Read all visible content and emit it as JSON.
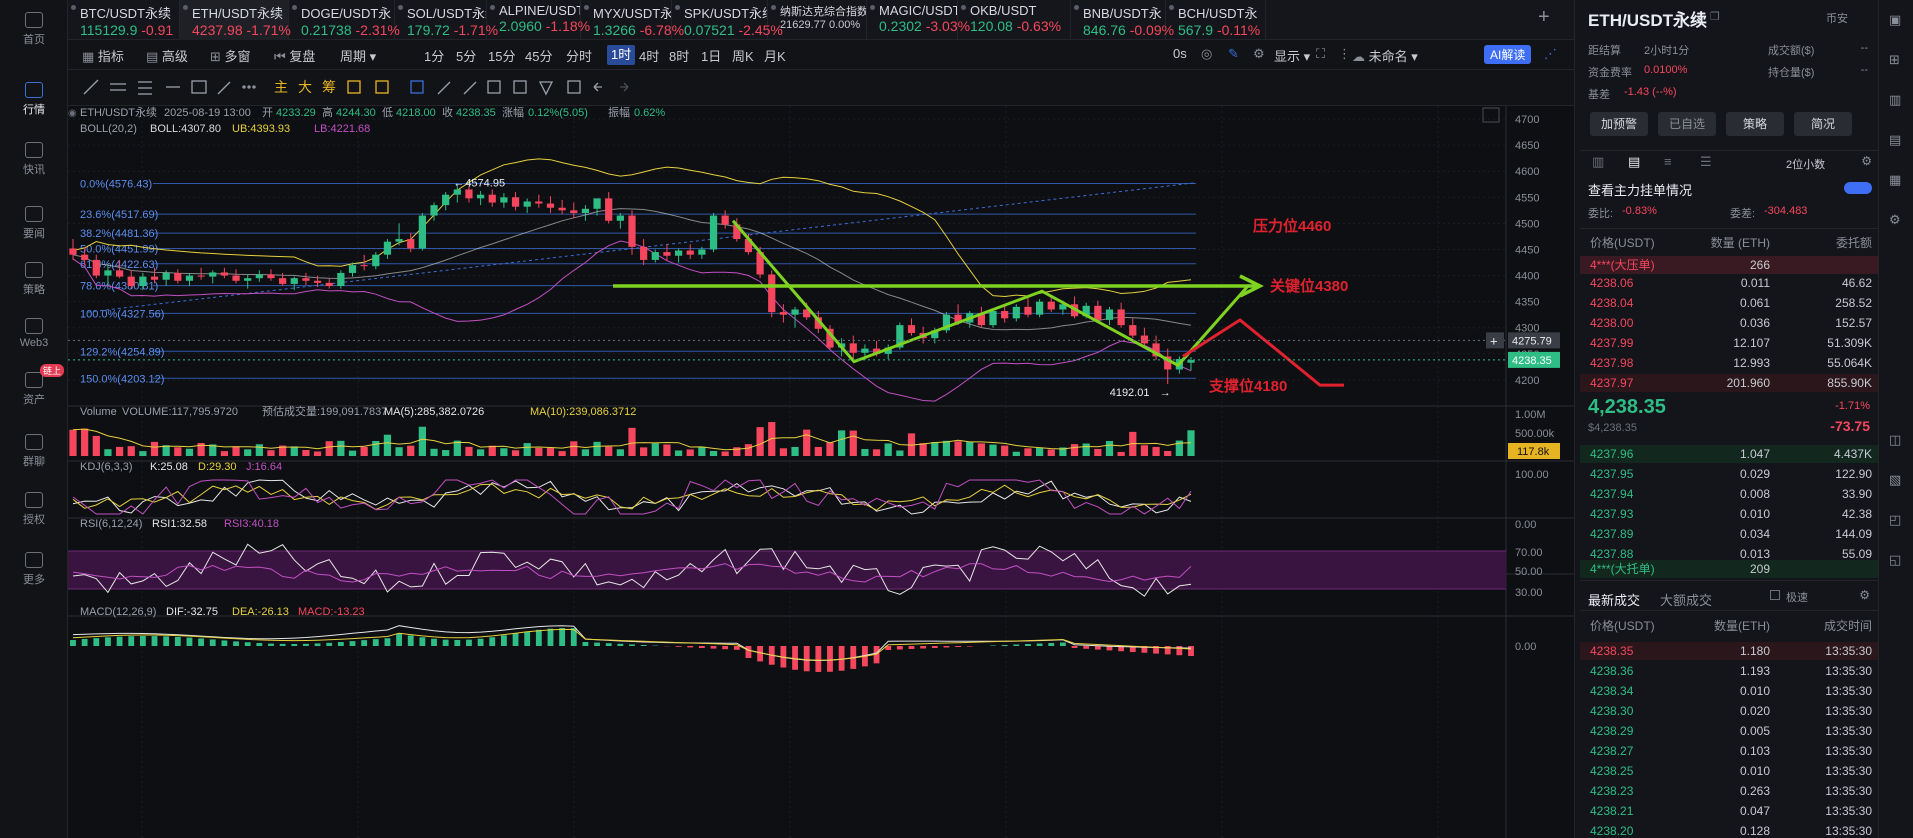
{
  "nav": [
    {
      "label": "首页",
      "icon": "home-icon"
    },
    {
      "label": "行情",
      "icon": "market-chart-icon",
      "active": true
    },
    {
      "label": "快讯",
      "icon": "flash-news-icon"
    },
    {
      "label": "要闻",
      "icon": "news-icon"
    },
    {
      "label": "策略",
      "icon": "strategy-robot-icon"
    },
    {
      "label": "Web3",
      "icon": "web3-icon"
    },
    {
      "label": "资产",
      "icon": "wallet-icon",
      "badge": "链上"
    },
    {
      "label": "群聊",
      "icon": "chat-icon"
    },
    {
      "label": "授权",
      "icon": "auth-icon"
    },
    {
      "label": "更多",
      "icon": "more-icon"
    }
  ],
  "tickers": [
    {
      "name": "BTC/USDT永续",
      "price": "115129.9",
      "change": "-0.91"
    },
    {
      "name": "ETH/USDT永续",
      "price": "4237.98",
      "change": "-1.71%",
      "selected": true
    },
    {
      "name": "DOGE/USDT永",
      "price": "0.21738",
      "change": "-2.31%"
    },
    {
      "name": "SOL/USDT永续",
      "price": "179.72",
      "change": "-1.71%"
    },
    {
      "name": "ALPINE/USDT",
      "price": "2.0960",
      "change": "-1.18%"
    },
    {
      "name": "MYX/USDT永",
      "price": "1.3266",
      "change": "-6.78%"
    },
    {
      "name": "SPK/USDT永续",
      "price": "0.07521",
      "change": "-2.45%"
    },
    {
      "name": "纳斯达克综合指数",
      "price": "21629.77",
      "change": "0.00%",
      "neutral": true
    },
    {
      "name": "MAGIC/USDT",
      "price": "0.2302",
      "change": "-3.03%"
    },
    {
      "name": "OKB/USDT",
      "price": "120.08",
      "change": "-0.63%"
    },
    {
      "name": "BNB/USDT永",
      "price": "846.76",
      "change": "-0.09%"
    },
    {
      "name": "BCH/USDT永",
      "price": "567.9",
      "change": "-0.11%"
    }
  ],
  "add_tab": "+",
  "toolbar": {
    "indicators": "指标",
    "advanced": "高级",
    "multi": "多窗",
    "replay": "复盘",
    "period": "周期",
    "intervals": [
      "1分",
      "5分",
      "15分",
      "45分",
      "分时",
      "1时",
      "4时",
      "8时",
      "1日",
      "周K",
      "月K"
    ],
    "active_interval": "1时",
    "zero_s": "0s",
    "display": "显示",
    "unnamed": "未命名",
    "ai": "AI解读"
  },
  "chart_header": {
    "symbol": "ETH/USDT永续",
    "date": "2025-08-19 13:00",
    "open_label": "开",
    "open": "4233.29",
    "high_label": "高",
    "high": "4244.30",
    "low_label": "低",
    "low": "4218.00",
    "close_label": "收",
    "close": "4238.35",
    "chg_label": "涨幅",
    "chg": "0.12%(5.05)",
    "amp_label": "振幅",
    "amp": "0.62%",
    "boll": "BOLL(20,2)",
    "boll_mid": "BOLL:4307.80",
    "boll_ub": "UB:4393.93",
    "boll_lb": "LB:4221.68"
  },
  "volume_header": {
    "title": "Volume",
    "vol": "VOLUME:117,795.9720",
    "est": "预估成交量:199,091.7837",
    "ma5": "MA(5):285,382.0726",
    "ma10": "MA(10):239,086.3712"
  },
  "kdj_header": {
    "title": "KDJ(6,3,3)",
    "k": "K:25.08",
    "d": "D:29.30",
    "j": "J:16.64"
  },
  "rsi_header": {
    "title": "RSI(6,12,24)",
    "rsi1": "RSI1:32.58",
    "rsi3": "RSI3:40.18"
  },
  "macd_header": {
    "title": "MACD(12,26,9)",
    "dif": "DIF:-32.75",
    "dea": "DEA:-26.13",
    "macd": "MACD:-13.23"
  },
  "annotations": {
    "resistance": "压力位4460",
    "key": "关键位4380",
    "support": "支撑位4180",
    "high_mark": "4574.95",
    "low_mark": "4192.01"
  },
  "colors": {
    "up": "#2ebd85",
    "down": "#f6465d",
    "fib": "#3b6fd8",
    "boll_mid": "#d9d9d9",
    "boll_ub": "#e6d03c",
    "boll_lb": "#c24fc4",
    "annot_green": "#7ed321",
    "annot_red": "#e0212e"
  },
  "chart_data": {
    "type": "candlestick",
    "interval": "1h",
    "price_axis": {
      "min": 4150,
      "max": 4725,
      "ticks": [
        4700,
        4650,
        4600,
        4550,
        4500,
        4450,
        4400,
        4350,
        4300,
        4250,
        4200
      ]
    },
    "price_tags": [
      {
        "value": "4275.79"
      },
      {
        "value": "4238.35"
      }
    ],
    "fibonacci": [
      {
        "label": "0.0%(4576.43)",
        "value": 4576.43
      },
      {
        "label": "23.6%(4517.69)",
        "value": 4517.69
      },
      {
        "label": "38.2%(4481.36)",
        "value": 4481.36
      },
      {
        "label": "50.0%(4451.99)",
        "value": 4451.99
      },
      {
        "label": "61.8%(4422.63)",
        "value": 4422.63
      },
      {
        "label": "78.6%(4380.81)",
        "value": 4380.81
      },
      {
        "label": "100.0%(4327.56)",
        "value": 4327.56
      },
      {
        "label": "129.2%(4254.89)",
        "value": 4254.89
      },
      {
        "label": "150.0%(4203.12)",
        "value": 4203.12
      }
    ],
    "candles": [
      [
        4452,
        4470,
        4430,
        4440
      ],
      [
        4440,
        4455,
        4420,
        4430
      ],
      [
        4430,
        4440,
        4395,
        4400
      ],
      [
        4400,
        4420,
        4380,
        4410
      ],
      [
        4410,
        4430,
        4395,
        4398
      ],
      [
        4398,
        4410,
        4375,
        4380
      ],
      [
        4380,
        4405,
        4372,
        4398
      ],
      [
        4398,
        4415,
        4385,
        4392
      ],
      [
        4392,
        4410,
        4380,
        4405
      ],
      [
        4405,
        4412,
        4385,
        4390
      ],
      [
        4390,
        4405,
        4380,
        4400
      ],
      [
        4400,
        4415,
        4392,
        4398
      ],
      [
        4398,
        4410,
        4385,
        4406
      ],
      [
        4406,
        4415,
        4395,
        4400
      ],
      [
        4400,
        4412,
        4385,
        4390
      ],
      [
        4390,
        4402,
        4375,
        4395
      ],
      [
        4395,
        4410,
        4388,
        4402
      ],
      [
        4402,
        4412,
        4390,
        4395
      ],
      [
        4395,
        4405,
        4380,
        4384
      ],
      [
        4384,
        4398,
        4372,
        4395
      ],
      [
        4395,
        4405,
        4382,
        4390
      ],
      [
        4390,
        4400,
        4378,
        4386
      ],
      [
        4386,
        4395,
        4375,
        4380
      ],
      [
        4380,
        4410,
        4375,
        4405
      ],
      [
        4405,
        4425,
        4398,
        4420
      ],
      [
        4420,
        4440,
        4410,
        4418
      ],
      [
        4418,
        4445,
        4412,
        4440
      ],
      [
        4440,
        4470,
        4432,
        4465
      ],
      [
        4465,
        4500,
        4458,
        4470
      ],
      [
        4470,
        4482,
        4445,
        4452
      ],
      [
        4452,
        4520,
        4448,
        4515
      ],
      [
        4515,
        4540,
        4505,
        4535
      ],
      [
        4535,
        4560,
        4525,
        4555
      ],
      [
        4555,
        4575,
        4540,
        4565
      ],
      [
        4565,
        4572,
        4540,
        4548
      ],
      [
        4548,
        4562,
        4535,
        4555
      ],
      [
        4555,
        4565,
        4532,
        4540
      ],
      [
        4540,
        4558,
        4530,
        4550
      ],
      [
        4550,
        4560,
        4525,
        4532
      ],
      [
        4532,
        4548,
        4520,
        4542
      ],
      [
        4542,
        4555,
        4530,
        4538
      ],
      [
        4538,
        4552,
        4520,
        4530
      ],
      [
        4530,
        4545,
        4518,
        4525
      ],
      [
        4525,
        4540,
        4510,
        4520
      ],
      [
        4520,
        4535,
        4505,
        4528
      ],
      [
        4528,
        4540,
        4515,
        4548
      ],
      [
        4548,
        4560,
        4500,
        4505
      ],
      [
        4505,
        4520,
        4490,
        4515
      ],
      [
        4515,
        4525,
        4440,
        4455
      ],
      [
        4455,
        4470,
        4420,
        4430
      ],
      [
        4430,
        4450,
        4425,
        4445
      ],
      [
        4445,
        4460,
        4428,
        4438
      ],
      [
        4438,
        4452,
        4425,
        4448
      ],
      [
        4448,
        4460,
        4432,
        4440
      ],
      [
        4440,
        4455,
        4432,
        4450
      ],
      [
        4450,
        4520,
        4445,
        4515
      ],
      [
        4515,
        4525,
        4490,
        4498
      ],
      [
        4498,
        4510,
        4465,
        4470
      ],
      [
        4470,
        4480,
        4440,
        4445
      ],
      [
        4445,
        4455,
        4395,
        4402
      ],
      [
        4402,
        4410,
        4320,
        4330
      ],
      [
        4330,
        4345,
        4310,
        4325
      ],
      [
        4325,
        4340,
        4300,
        4335
      ],
      [
        4335,
        4348,
        4315,
        4320
      ],
      [
        4320,
        4332,
        4290,
        4298
      ],
      [
        4298,
        4305,
        4258,
        4262
      ],
      [
        4262,
        4280,
        4245,
        4270
      ],
      [
        4270,
        4285,
        4240,
        4252
      ],
      [
        4252,
        4268,
        4238,
        4260
      ],
      [
        4260,
        4275,
        4245,
        4250
      ],
      [
        4250,
        4268,
        4240,
        4262
      ],
      [
        4262,
        4310,
        4258,
        4305
      ],
      [
        4305,
        4318,
        4285,
        4290
      ],
      [
        4290,
        4302,
        4270,
        4280
      ],
      [
        4280,
        4300,
        4270,
        4295
      ],
      [
        4295,
        4330,
        4290,
        4325
      ],
      [
        4325,
        4345,
        4305,
        4310
      ],
      [
        4310,
        4332,
        4300,
        4328
      ],
      [
        4328,
        4340,
        4300,
        4305
      ],
      [
        4305,
        4335,
        4300,
        4332
      ],
      [
        4332,
        4345,
        4310,
        4318
      ],
      [
        4318,
        4345,
        4312,
        4340
      ],
      [
        4340,
        4360,
        4320,
        4325
      ],
      [
        4325,
        4355,
        4320,
        4350
      ],
      [
        4350,
        4362,
        4330,
        4335
      ],
      [
        4335,
        4352,
        4325,
        4345
      ],
      [
        4345,
        4360,
        4318,
        4322
      ],
      [
        4322,
        4348,
        4318,
        4342
      ],
      [
        4342,
        4352,
        4310,
        4315
      ],
      [
        4315,
        4340,
        4305,
        4335
      ],
      [
        4335,
        4348,
        4300,
        4305
      ],
      [
        4305,
        4318,
        4280,
        4285
      ],
      [
        4285,
        4300,
        4262,
        4270
      ],
      [
        4270,
        4285,
        4238,
        4245
      ],
      [
        4245,
        4260,
        4192,
        4220
      ],
      [
        4220,
        4245,
        4212,
        4240
      ],
      [
        4233,
        4244,
        4218,
        4238
      ]
    ],
    "volume_axis": {
      "ticks": [
        "1.00M",
        "500.00k"
      ],
      "tag": "117.8k"
    },
    "kdj_axis": {
      "ticks": [
        "100.00",
        "0.00"
      ]
    },
    "rsi_axis": {
      "ticks": [
        "70.00",
        "50.00",
        "30.00"
      ]
    },
    "macd_axis": {
      "ticks": [
        "0.00"
      ]
    }
  },
  "right_panel": {
    "symbol": "ETH/USDT永续",
    "exchange": "币安",
    "funding_label": "距结算",
    "funding_time": "2小时1分",
    "turnover_label": "成交额($)",
    "turnover": "--",
    "fee_label": "资金费率",
    "fee": "0.0100%",
    "oi_label": "持仓量($)",
    "oi": "--",
    "basis_label": "基差",
    "basis": "-1.43 (--%)",
    "buttons": [
      "加预警",
      "已自选",
      "策略",
      "简况"
    ],
    "precision": "2位小数",
    "whale_title": "查看主力挂单情况",
    "ratio_label": "委比:",
    "ratio": "-0.83%",
    "diff_label": "委差:",
    "diff": "-304.483",
    "cols": [
      "价格(USDT)",
      "数量 (ETH)",
      "委托额"
    ],
    "ask_whale": {
      "price": "4***(大压单)",
      "qty": "266"
    },
    "asks": [
      {
        "price": "4238.06",
        "qty": "0.011",
        "amt": "46.62"
      },
      {
        "price": "4238.04",
        "qty": "0.061",
        "amt": "258.52"
      },
      {
        "price": "4238.00",
        "qty": "0.036",
        "amt": "152.57"
      },
      {
        "price": "4237.99",
        "qty": "12.107",
        "amt": "51.309K"
      },
      {
        "price": "4237.98",
        "qty": "12.993",
        "amt": "55.064K"
      },
      {
        "price": "4237.97",
        "qty": "201.960",
        "amt": "855.90K"
      }
    ],
    "last_price": "4,238.35",
    "last_usd": "$4,238.35",
    "last_pct": "-1.71%",
    "last_chg": "-73.75",
    "bids": [
      {
        "price": "4237.96",
        "qty": "1.047",
        "amt": "4.437K"
      },
      {
        "price": "4237.95",
        "qty": "0.029",
        "amt": "122.90"
      },
      {
        "price": "4237.94",
        "qty": "0.008",
        "amt": "33.90"
      },
      {
        "price": "4237.93",
        "qty": "0.010",
        "amt": "42.38"
      },
      {
        "price": "4237.89",
        "qty": "0.034",
        "amt": "144.09"
      },
      {
        "price": "4237.88",
        "qty": "0.013",
        "amt": "55.09"
      }
    ],
    "bid_whale": {
      "price": "4***(大托单)",
      "qty": "209"
    },
    "trades_tab": "最新成交",
    "big_tab": "大额成交",
    "fast_label": "极速",
    "trade_cols": [
      "价格(USDT)",
      "数量(ETH)",
      "成交时间"
    ],
    "trades": [
      {
        "price": "4238.35",
        "qty": "1.180",
        "time": "13:35:30",
        "dir": "dn"
      },
      {
        "price": "4238.36",
        "qty": "1.193",
        "time": "13:35:30",
        "dir": "up"
      },
      {
        "price": "4238.34",
        "qty": "0.010",
        "time": "13:35:30",
        "dir": "up"
      },
      {
        "price": "4238.30",
        "qty": "0.020",
        "time": "13:35:30",
        "dir": "up"
      },
      {
        "price": "4238.29",
        "qty": "0.005",
        "time": "13:35:30",
        "dir": "up"
      },
      {
        "price": "4238.27",
        "qty": "0.103",
        "time": "13:35:30",
        "dir": "up"
      },
      {
        "price": "4238.25",
        "qty": "0.010",
        "time": "13:35:30",
        "dir": "up"
      },
      {
        "price": "4238.23",
        "qty": "0.263",
        "time": "13:35:30",
        "dir": "up"
      },
      {
        "price": "4238.21",
        "qty": "0.047",
        "time": "13:35:30",
        "dir": "up"
      },
      {
        "price": "4238.20",
        "qty": "0.128",
        "time": "13:35:30",
        "dir": "up"
      }
    ]
  }
}
